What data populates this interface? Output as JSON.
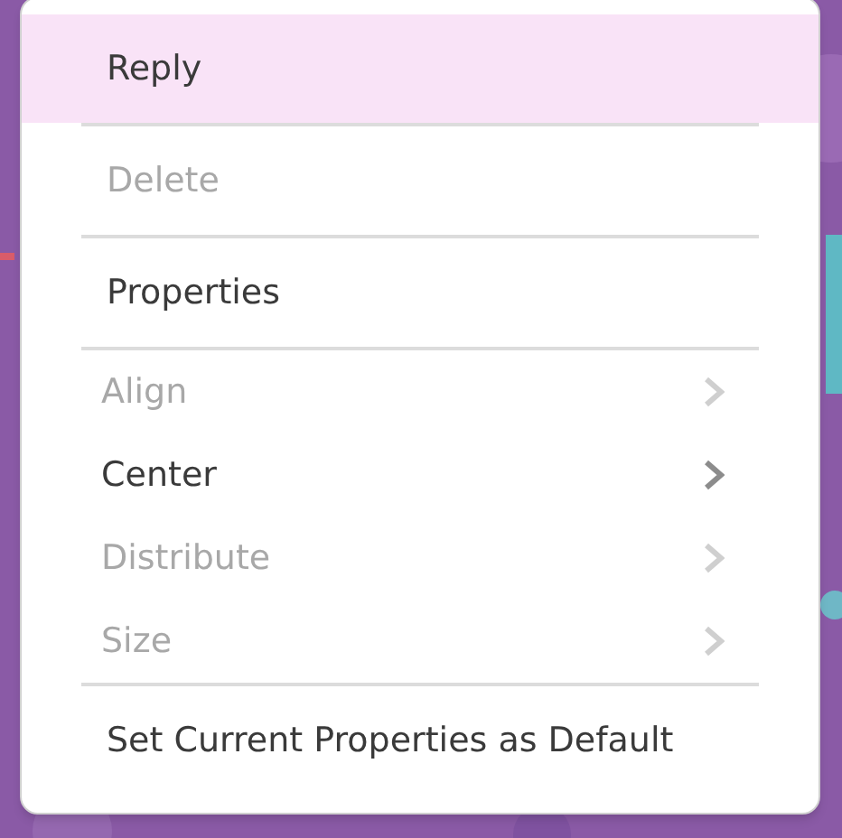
{
  "menu": {
    "groups": [
      {
        "items": [
          {
            "label": "Reply",
            "kind": "action",
            "selected": true,
            "disabled": false
          }
        ]
      },
      {
        "items": [
          {
            "label": "Delete",
            "kind": "action",
            "selected": false,
            "disabled": true
          }
        ]
      },
      {
        "items": [
          {
            "label": "Properties",
            "kind": "action",
            "selected": false,
            "disabled": false
          }
        ]
      },
      {
        "items": [
          {
            "label": "Align",
            "kind": "submenu",
            "selected": false,
            "disabled": true
          },
          {
            "label": "Center",
            "kind": "submenu",
            "selected": false,
            "disabled": false
          },
          {
            "label": "Distribute",
            "kind": "submenu",
            "selected": false,
            "disabled": true
          },
          {
            "label": "Size",
            "kind": "submenu",
            "selected": false,
            "disabled": true
          }
        ]
      },
      {
        "items": [
          {
            "label": "Set Current Properties as Default",
            "kind": "action",
            "selected": false,
            "disabled": false
          }
        ]
      }
    ]
  }
}
